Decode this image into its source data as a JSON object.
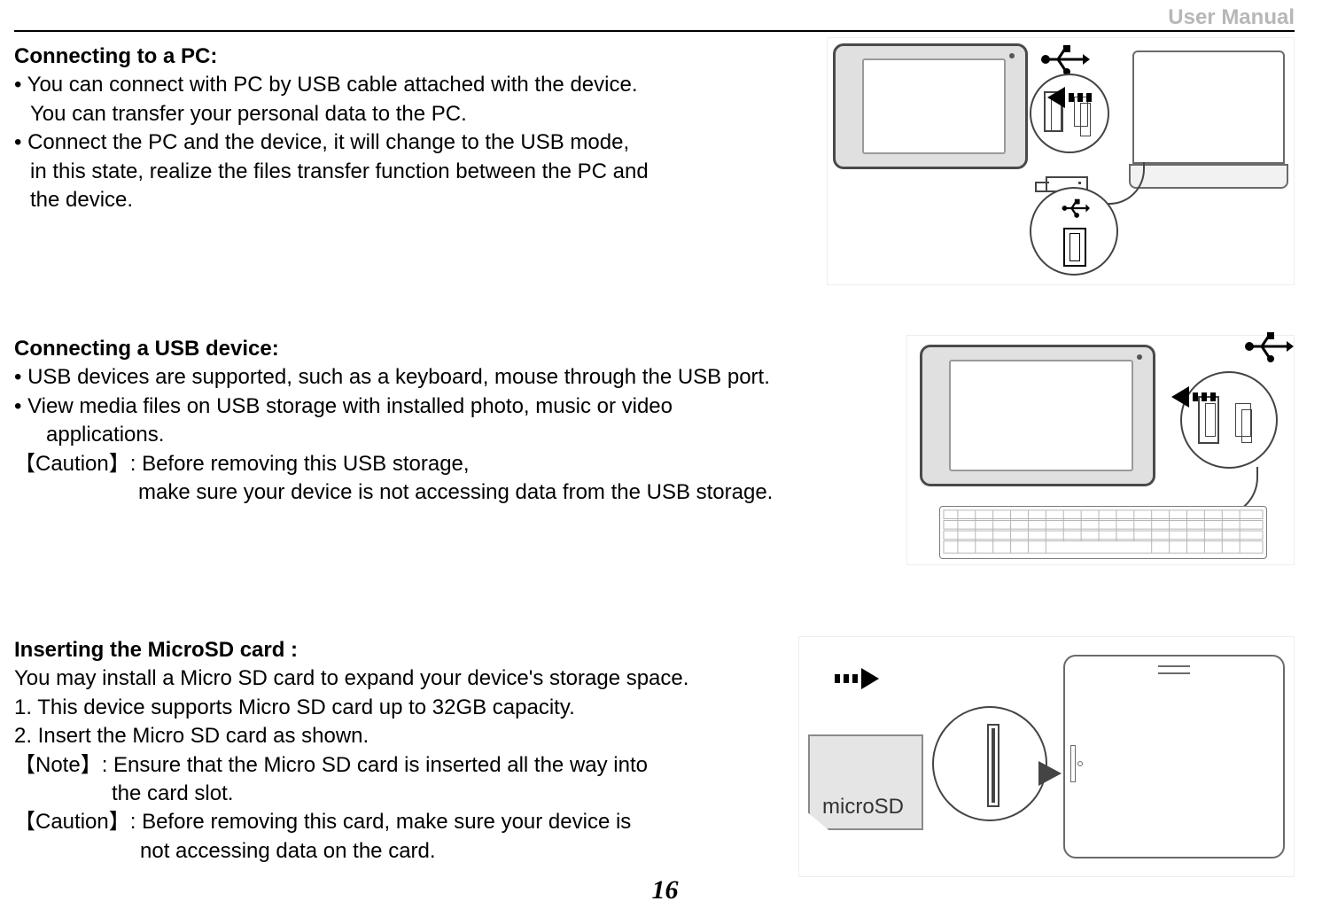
{
  "header": {
    "label": "User Manual"
  },
  "page_number": "16",
  "sections": {
    "pc": {
      "title": "Connecting to a PC:",
      "b1": "• You can connect with PC by USB cable attached with the device.",
      "b1_l2": "You can transfer your personal data to the PC.",
      "b2": "• Connect the PC and the device, it will change to the USB mode,",
      "b2_l2": "in this state, realize the files transfer function between the PC and",
      "b2_l3": "the device."
    },
    "usb": {
      "title": "Connecting a USB device:",
      "b1": "• USB devices are supported, such as a keyboard, mouse through the USB port.",
      "b2": "• View media files on USB storage with installed photo, music or video",
      "b2_l2": "applications.",
      "caution_label": "【Caution】",
      "caution_t1": ": Before removing this USB storage,",
      "caution_t2": "make sure your device is not accessing data from the USB storage."
    },
    "sd": {
      "title": "Inserting the MicroSD card :",
      "intro": "You may install a Micro SD card to expand your device's storage space.",
      "s1": "1. This device supports Micro SD card up to 32GB capacity.",
      "s2": "2. Insert the Micro SD card as shown.",
      "note_label": "【Note】",
      "note_t1": ": Ensure that the Micro SD card is inserted all the way into",
      "note_t2": "the card slot.",
      "caution_label": "【Caution】",
      "caution_t1": ": Before removing this card, make sure your device is",
      "caution_t2": "not accessing data on the card.",
      "card_label": "microSD"
    }
  }
}
